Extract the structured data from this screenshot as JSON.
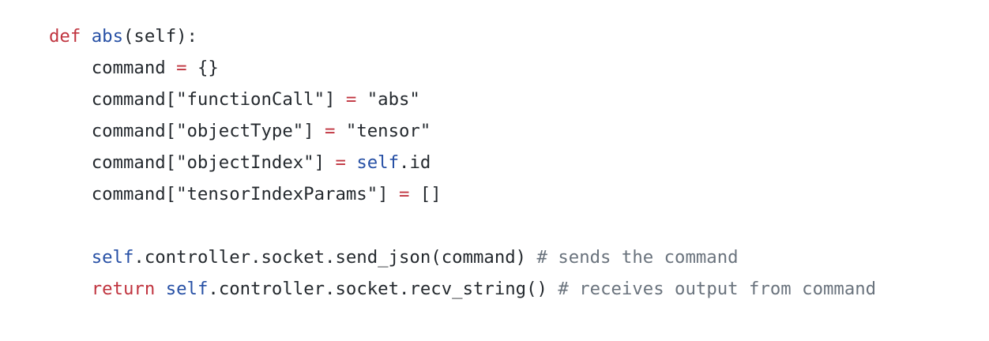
{
  "code": {
    "lines": [
      {
        "tokens": [
          {
            "type": "keyword",
            "text": "def"
          },
          {
            "type": "plain",
            "text": " "
          },
          {
            "type": "funcname",
            "text": "abs"
          },
          {
            "type": "plain",
            "text": "(self):"
          }
        ]
      },
      {
        "tokens": [
          {
            "type": "plain",
            "text": "    command "
          },
          {
            "type": "op",
            "text": "="
          },
          {
            "type": "plain",
            "text": " {}"
          }
        ]
      },
      {
        "tokens": [
          {
            "type": "plain",
            "text": "    command[\"functionCall\"] "
          },
          {
            "type": "op",
            "text": "="
          },
          {
            "type": "plain",
            "text": " \"abs\""
          }
        ]
      },
      {
        "tokens": [
          {
            "type": "plain",
            "text": "    command[\"objectType\"] "
          },
          {
            "type": "op",
            "text": "="
          },
          {
            "type": "plain",
            "text": " \"tensor\""
          }
        ]
      },
      {
        "tokens": [
          {
            "type": "plain",
            "text": "    command[\"objectIndex\"] "
          },
          {
            "type": "op",
            "text": "="
          },
          {
            "type": "plain",
            "text": " "
          },
          {
            "type": "self",
            "text": "self"
          },
          {
            "type": "plain",
            "text": ".id"
          }
        ]
      },
      {
        "tokens": [
          {
            "type": "plain",
            "text": "    command[\"tensorIndexParams\"] "
          },
          {
            "type": "op",
            "text": "="
          },
          {
            "type": "plain",
            "text": " []"
          }
        ]
      },
      {
        "tokens": []
      },
      {
        "tokens": [
          {
            "type": "plain",
            "text": "    "
          },
          {
            "type": "self",
            "text": "self"
          },
          {
            "type": "plain",
            "text": ".controller.socket.send_json(command) "
          },
          {
            "type": "comment",
            "text": "# sends the command"
          }
        ]
      },
      {
        "tokens": [
          {
            "type": "plain",
            "text": "    "
          },
          {
            "type": "keyword",
            "text": "return"
          },
          {
            "type": "plain",
            "text": " "
          },
          {
            "type": "self",
            "text": "self"
          },
          {
            "type": "plain",
            "text": ".controller.socket.recv_string() "
          },
          {
            "type": "comment",
            "text": "# receives output from command"
          }
        ]
      }
    ]
  },
  "colors": {
    "keyword": "#c0343f",
    "funcname": "#2750a5",
    "self": "#2750a5",
    "comment": "#6a737d",
    "text": "#24292e",
    "background": "#ffffff"
  }
}
